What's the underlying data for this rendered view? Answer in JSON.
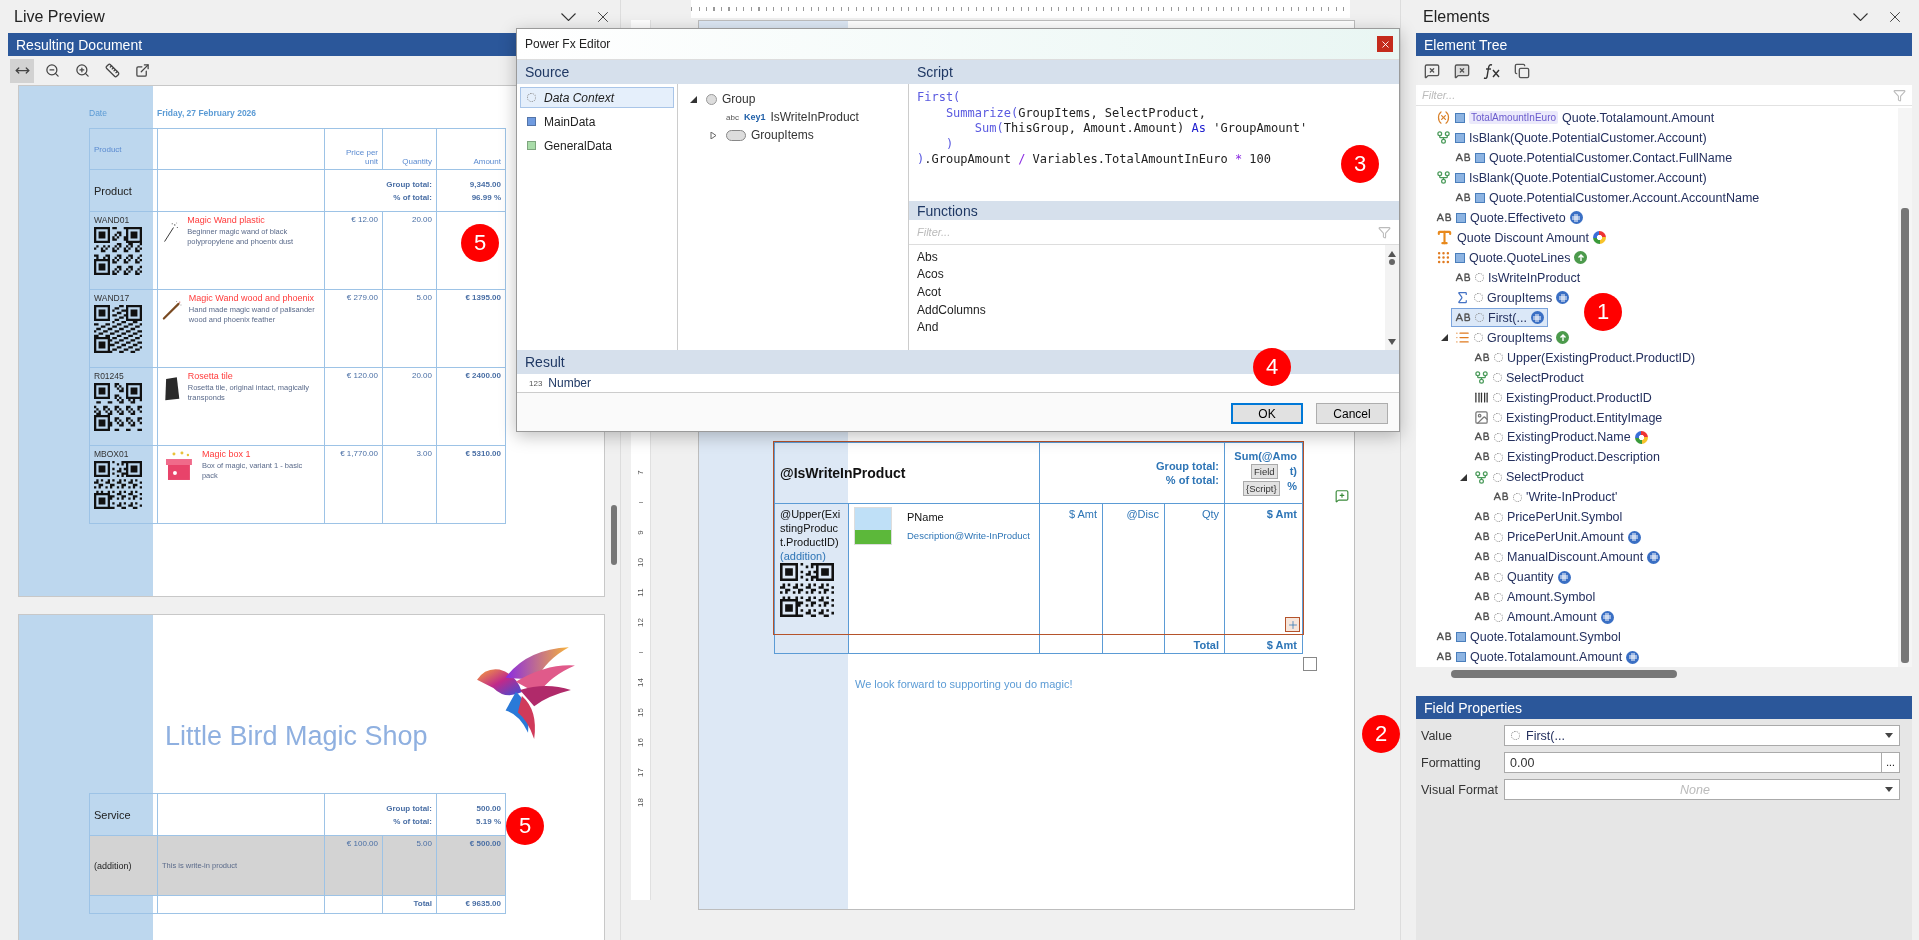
{
  "live_preview": {
    "title": "Live Preview",
    "subtitle": "Resulting Document",
    "toolbar": [
      {
        "kind": "fit-width",
        "selected": true
      },
      {
        "kind": "zoom-out",
        "selected": false
      },
      {
        "kind": "zoom-in",
        "selected": false
      },
      {
        "kind": "ruler",
        "selected": false
      },
      {
        "kind": "pop-out",
        "selected": false
      }
    ],
    "page_1": {
      "date_label": "Date",
      "date": "Friday, 27 February 2026",
      "columns": [
        "Product",
        "Price per unit",
        "Quantity",
        "Amount"
      ],
      "group": {
        "name": "Product",
        "total_label": "Group total:",
        "percent_label": "% of total:",
        "total": "9,345.00",
        "percent": "96.99 %"
      },
      "rows": [
        {
          "code": "WAND01",
          "kind": "wand",
          "name": "Magic Wand plastic",
          "description": "Beginner magic wand of black polypropylene and phoenix dust",
          "price": "€ 12.00",
          "quantity": "20.00"
        },
        {
          "code": "WAND17",
          "kind": "wood-wand",
          "name": "Magic Wand wood and phoenix",
          "description": "Hand made magic wand of palisander wood and phoenix feather",
          "price": "€ 279.00",
          "quantity": "5.00",
          "amount": "€ 1395.00"
        },
        {
          "code": "R01245",
          "kind": "tile",
          "name": "Rosetta tile",
          "description": "Rosetta tile, original intact, magically transponds",
          "price": "€ 120.00",
          "quantity": "20.00",
          "amount": "€ 2400.00"
        },
        {
          "code": "MBOX01",
          "kind": "gift",
          "name": "Magic box 1",
          "description": "Box of magic, variant 1 - basic pack",
          "price": "€ 1,770.00",
          "quantity": "3.00",
          "amount": "€ 5310.00"
        }
      ]
    },
    "page_2": {
      "shop_name": "Little Bird Magic Shop",
      "group": {
        "name": "Service",
        "total_label": "Group total:",
        "percent_label": "% of total:",
        "total": "500.00",
        "percent": "5.19 %"
      },
      "rows": [
        {
          "code": "(addition)",
          "description": "This is write-in product",
          "price": "€ 100.00",
          "quantity": "5.00",
          "amount": "€ 500.00",
          "highlighted": true
        }
      ],
      "total_label": "Total",
      "total": "€ 9635.00"
    },
    "callouts": [
      "5",
      "5"
    ]
  },
  "designer": {
    "ruler_marks": [
      {
        "kind": "number",
        "label": "7"
      },
      {
        "kind": "tick"
      },
      {
        "kind": "number",
        "label": "9"
      },
      {
        "kind": "number",
        "label": "10"
      },
      {
        "kind": "number",
        "label": "11"
      },
      {
        "kind": "number",
        "label": "12"
      },
      {
        "kind": "tick"
      },
      {
        "kind": "number",
        "label": "14"
      },
      {
        "kind": "number",
        "label": "15"
      },
      {
        "kind": "number",
        "label": "16"
      },
      {
        "kind": "number",
        "label": "17"
      },
      {
        "kind": "number",
        "label": "18"
      }
    ],
    "group_row": {
      "name": "@IsWriteInProduct",
      "total_label": "Group total:",
      "percent_label": "% of total:",
      "amount_lines": [
        "Sum(@Amo",
        "t)",
        "%"
      ],
      "field_tags": [
        "Field",
        "{Script}"
      ]
    },
    "detail_row": {
      "code": "@Upper(ExistingProduct.ProductID)",
      "code_note": "(addition)",
      "name": "PName",
      "description": "Description@Write-InProduct",
      "price": "$ Amt",
      "discount": "@Disc",
      "quantity": "Qty",
      "amount": "$ Amt"
    },
    "total_row": {
      "label": "Total",
      "amount": "$ Amt"
    },
    "footer": "We look forward to supporting you do magic!",
    "callouts": [
      "2"
    ]
  },
  "elements": {
    "title": "Elements",
    "subtitle": "Element Tree",
    "toolbar": [
      {
        "kind": "remove-comment"
      },
      {
        "kind": "remove-comment-filled"
      },
      {
        "kind": "function"
      },
      {
        "kind": "copy"
      }
    ],
    "filter_placeholder": "Filter...",
    "tree": [
      {
        "kind": "variable",
        "from_data": true,
        "tag": "TotalAmountInEuro",
        "label": "Quote.Totalamount.Amount",
        "selected": false
      },
      {
        "kind": "condition",
        "from_data": true,
        "label": "IsBlank(Quote.PotentialCustomer.Account)",
        "selected": false,
        "children": [
          {
            "kind": "text",
            "from_data": true,
            "label": "Quote.PotentialCustomer.Contact.FullName",
            "selected": false
          }
        ]
      },
      {
        "kind": "condition",
        "from_data": true,
        "label": "IsBlank(Quote.PotentialCustomer.Account)",
        "selected": false,
        "children": [
          {
            "kind": "text",
            "from_data": true,
            "label": "Quote.PotentialCustomer.Account.AccountName",
            "selected": false
          }
        ]
      },
      {
        "kind": "text",
        "from_data": true,
        "label": "Quote.Effectiveto",
        "number_format": true,
        "selected": false
      },
      {
        "kind": "letter",
        "label": "Quote Discount Amount",
        "color_format": true,
        "selected": false
      },
      {
        "kind": "grid",
        "from_data": true,
        "label": "Quote.QuoteLines",
        "sorted": true,
        "selected": false,
        "children": [
          {
            "kind": "text",
            "from_data": false,
            "label": "IsWriteInProduct",
            "selected": false
          },
          {
            "kind": "sum",
            "from_data": false,
            "label": "GroupItems",
            "number_format": true,
            "selected": false
          },
          {
            "kind": "text",
            "from_data": false,
            "label": "First(...",
            "number_format": true,
            "selected": true
          },
          {
            "kind": "list",
            "from_data": false,
            "label": "GroupItems",
            "sorted": true,
            "selected": false,
            "expanded": true,
            "children": [
              {
                "kind": "text",
                "from_data": false,
                "label": "Upper(ExistingProduct.ProductID)",
                "selected": false
              },
              {
                "kind": "condition",
                "from_data": false,
                "label": "SelectProduct",
                "selected": false
              },
              {
                "kind": "barcode",
                "from_data": false,
                "label": "ExistingProduct.ProductID",
                "selected": false
              },
              {
                "kind": "image",
                "from_data": false,
                "label": "ExistingProduct.EntityImage",
                "selected": false
              },
              {
                "kind": "text",
                "from_data": false,
                "label": "ExistingProduct.Name",
                "color_format": true,
                "selected": false
              },
              {
                "kind": "text",
                "from_data": false,
                "label": "ExistingProduct.Description",
                "selected": false
              },
              {
                "kind": "condition",
                "from_data": false,
                "label": "SelectProduct",
                "selected": false,
                "expanded": true,
                "children": [
                  {
                    "kind": "text",
                    "from_data": false,
                    "label": "'Write-InProduct'",
                    "selected": false
                  }
                ]
              },
              {
                "kind": "text",
                "from_data": false,
                "label": "PricePerUnit.Symbol",
                "selected": false
              },
              {
                "kind": "text",
                "from_data": false,
                "label": "PricePerUnit.Amount",
                "number_format": true,
                "selected": false
              },
              {
                "kind": "text",
                "from_data": false,
                "label": "ManualDiscount.Amount",
                "number_format": true,
                "selected": false
              },
              {
                "kind": "text",
                "from_data": false,
                "label": "Quantity",
                "number_format": true,
                "selected": false
              },
              {
                "kind": "text",
                "from_data": false,
                "label": "Amount.Symbol",
                "selected": false
              },
              {
                "kind": "text",
                "from_data": false,
                "label": "Amount.Amount",
                "number_format": true,
                "selected": false
              }
            ]
          }
        ]
      },
      {
        "kind": "text",
        "from_data": true,
        "label": "Quote.Totalamount.Symbol",
        "selected": false
      },
      {
        "kind": "text",
        "from_data": true,
        "label": "Quote.Totalamount.Amount",
        "number_format": true,
        "selected": false
      }
    ],
    "properties": {
      "title": "Field Properties",
      "fields": [
        {
          "label": "Value",
          "kind": "select",
          "value": "First(..."
        },
        {
          "label": "Formatting",
          "kind": "text",
          "value": "0.00",
          "button": "..."
        },
        {
          "label": "Visual Format",
          "kind": "select",
          "placeholder": "None"
        }
      ]
    },
    "callouts": [
      "1"
    ]
  },
  "dialog": {
    "title": "Power Fx Editor",
    "source": {
      "title": "Source",
      "items": [
        {
          "label": "Data Context",
          "kind": "context",
          "selected": true
        },
        {
          "label": "MainData",
          "kind": "table",
          "color": "#6f9be0",
          "selected": false
        },
        {
          "label": "GeneralData",
          "kind": "table",
          "color": "#a9dca9",
          "selected": false
        }
      ],
      "tree": [
        {
          "kind": "group",
          "label": "Group",
          "expanded": true,
          "children": [
            {
              "kind": "field",
              "type_label": "abc",
              "key": "Key1",
              "label": "IsWriteInProduct"
            },
            {
              "kind": "collection",
              "label": "GroupItems",
              "expanded": false
            }
          ]
        }
      ]
    },
    "script": {
      "title": "Script",
      "lines": [
        [
          {
            "kind": "fn",
            "text": "First("
          }
        ],
        [
          {
            "kind": "fn",
            "text": "    Summarize("
          },
          {
            "kind": "text",
            "text": "GroupItems, SelectProduct,"
          }
        ],
        [
          {
            "kind": "fn",
            "text": "        Sum("
          },
          {
            "kind": "text",
            "text": "ThisGroup, Amount.Amount) "
          },
          {
            "kind": "kw",
            "text": "As"
          },
          {
            "kind": "text",
            "text": " 'GroupAmount'"
          }
        ],
        [
          {
            "kind": "fn",
            "text": "    )"
          }
        ],
        [
          {
            "kind": "fn",
            "text": ")"
          },
          {
            "kind": "text",
            "text": ".GroupAmount "
          },
          {
            "kind": "op",
            "text": "/"
          },
          {
            "kind": "text",
            "text": " Variables.TotalAmountInEuro "
          },
          {
            "kind": "op",
            "text": "*"
          },
          {
            "kind": "text",
            "text": " 100"
          }
        ]
      ]
    },
    "functions": {
      "title": "Functions",
      "filter_placeholder": "Filter...",
      "items": [
        "Abs",
        "Acos",
        "Acot",
        "AddColumns",
        "And"
      ]
    },
    "result": {
      "title": "Result",
      "type_label": "123",
      "value": "Number"
    },
    "buttons": [
      {
        "label": "OK",
        "default": true
      },
      {
        "label": "Cancel",
        "default": false
      }
    ],
    "callouts": [
      "3",
      "4"
    ]
  }
}
